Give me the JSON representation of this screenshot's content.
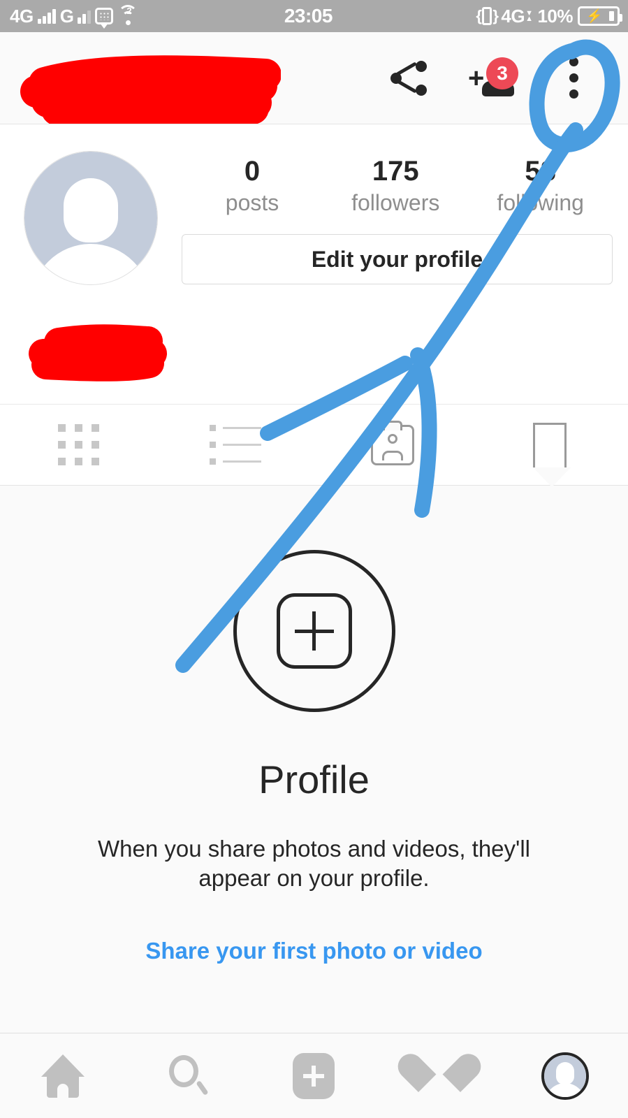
{
  "status_bar": {
    "network_primary": "4G",
    "network_secondary": "G",
    "wifi_superscript": "2",
    "time": "23:05",
    "data_network": "4G",
    "battery_percent": "10%",
    "icons": [
      "signal-bars-icon",
      "message-icon",
      "hotspot-icon",
      "vibrate-icon",
      "battery-charging-icon"
    ]
  },
  "app_header": {
    "username_redacted": true,
    "share_label": "share",
    "add_person_label": "discover people",
    "notification_badge": "3",
    "overflow_label": "options"
  },
  "profile": {
    "avatar_alt": "default profile photo",
    "stats": [
      {
        "value": "0",
        "label": "posts"
      },
      {
        "value": "175",
        "label": "followers"
      },
      {
        "value": "58",
        "label": "following"
      }
    ],
    "edit_button": "Edit your profile",
    "bio_redacted": true
  },
  "tabs": [
    {
      "name": "grid",
      "icon": "grid-icon",
      "active": true
    },
    {
      "name": "list",
      "icon": "list-icon",
      "active": false
    },
    {
      "name": "tagged",
      "icon": "tagged-photos-icon",
      "active": false
    },
    {
      "name": "saved",
      "icon": "bookmark-icon",
      "active": false
    }
  ],
  "empty_state": {
    "icon": "add-photo-icon",
    "title": "Profile",
    "description": "When you share photos and videos, they'll appear on your profile.",
    "link": "Share your first photo or video"
  },
  "bottom_nav": [
    {
      "name": "home",
      "icon": "home-icon",
      "active": false
    },
    {
      "name": "search",
      "icon": "search-icon",
      "active": false
    },
    {
      "name": "add",
      "icon": "add-post-icon",
      "active": false
    },
    {
      "name": "activity",
      "icon": "heart-icon",
      "active": false
    },
    {
      "name": "profile",
      "icon": "profile-avatar-icon",
      "active": true
    }
  ],
  "annotations": {
    "redaction_color": "#ff0000",
    "marker_color": "#4a9de0",
    "circle_target": "overflow-menu",
    "arrow_description": "arrow pointing from add-photo area up to overflow menu"
  }
}
